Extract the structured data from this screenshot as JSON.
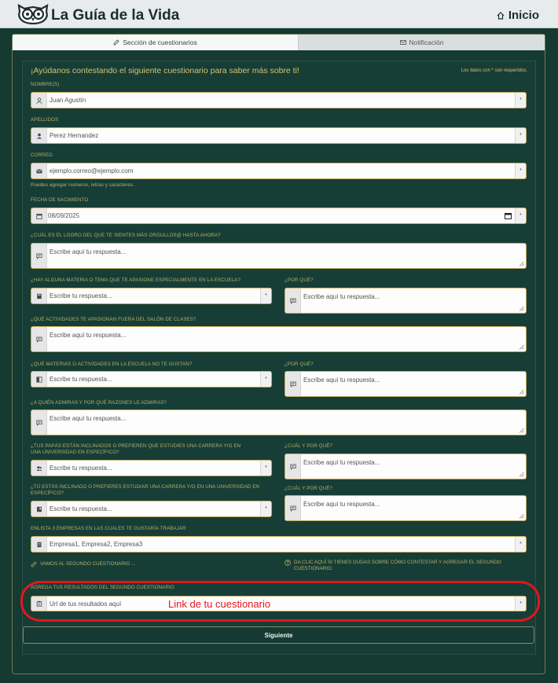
{
  "header": {
    "title": "La Guía de la Vida",
    "home_label": "Inicio"
  },
  "tabs": [
    {
      "label": "Sección de cuestionarios",
      "active": true
    },
    {
      "label": "Notificación",
      "active": false
    }
  ],
  "form": {
    "title": "¡Ayúdanos contestando el siguiente cuestionario para saber más sobre ti!",
    "required_note": "Los datos con * son requeridos.",
    "nombre": {
      "label": "NOMBRE(S)",
      "value": "Juan Agustín"
    },
    "apellidos": {
      "label": "APELLIDOS",
      "value": "Perez Hernandez"
    },
    "correo": {
      "label": "CORREO",
      "value": "ejemplo.correo@ejemplo.com",
      "helper": "Puedes agregar numeros, letras y caracteres."
    },
    "fecha": {
      "label": "FECHA DE NACIMIENTO",
      "value": "08/09/2025"
    },
    "logro": {
      "label": "¿CUÁL ES EL LOGRO DEL QUE TE SIENTES MÁS ORGULLOS@ HASTA AHORA?",
      "placeholder": "Escribe aquí tu respuesta..."
    },
    "materia_apasiona": {
      "label": "¿HAY ALGUNA MATERIA O TEMA QUE TE APASIONE ESPECIALMENTE EN LA ESCUELA?",
      "placeholder": "Escribe tu respuesta..."
    },
    "materia_apasiona_porque": {
      "label": "¿POR QUÉ?",
      "placeholder": "Escribe aquí tu respuesta..."
    },
    "actividades": {
      "label": "¿QUÉ ACTIVIDADES TE APASIONAN FUERA DEL SALÓN DE CLASES?",
      "placeholder": "Escribe aquí tu respuesta..."
    },
    "no_gustan": {
      "label": "¿QUÉ MATERIAS O ACTIVIDADES EN LA ESCUELA NO TE GUSTAN?",
      "placeholder": "Escribe tu respuesta..."
    },
    "no_gustan_porque": {
      "label": "¿POR QUÉ?",
      "placeholder": "Escribe aquí tu respuesta..."
    },
    "admiras": {
      "label": "¿A QUIÉN ADMIRAS Y POR QUÉ RAZONES LE ADMIRAS?",
      "placeholder": "Escribe aquí tu respuesta..."
    },
    "papas": {
      "label": "¿TUS PAPÁS ESTÁN INCLINADOS O PREFIEREN QUE ESTUDIES UNA CARRERA Y/O EN UNA UNIVERSIDAD EN ESPECÍFICO?",
      "placeholder": "Escribe tu respuesta..."
    },
    "papas_porque": {
      "label": "¿CUÁL Y POR QUÉ?",
      "placeholder": "Escribe aquí tu respuesta..."
    },
    "tu_inclinado": {
      "label": "¿TÚ ESTÁS INCLINADO O PREFIERES ESTUDIAR UNA CARRERA Y/O EN UNA UNIVERSIDAD EN ESPECÍFICO?",
      "placeholder": "Escribe tu respuesta..."
    },
    "tu_inclinado_porque": {
      "label": "¿CUÁL Y POR QUÉ?",
      "placeholder": "Escribe aquí tu respuesta..."
    },
    "empresas": {
      "label": "ENLISTA 3 EMPRESAS EN LAS CUALES TE GUSTARÍA TRABAJAR",
      "placeholder": "Empresa1, Empresa2, Empresa3"
    },
    "link_segundo": "VAMOS AL SEGUNDO CUESTIONARIO ...",
    "link_dudas": "DA CLIC AQUÍ SI TIENES DUDAS SOBRE CÓMO CONTESTAR Y AGREGAR EL SEGUNDO CUESTIONARIO.",
    "resultados": {
      "label": "AGREGA TUS RESULTADOS DEL SEGUNDO CUESTIONARIO",
      "placeholder": "Url de tus resultados aquí"
    },
    "required_mark": "*",
    "submit_label": "Siguiente"
  },
  "annotation": {
    "text": "Link de tu cuestionario",
    "color": "#e3161c"
  },
  "colors": {
    "background": "#143a32",
    "label": "#b9ac6a",
    "border": "#c7aa62"
  }
}
